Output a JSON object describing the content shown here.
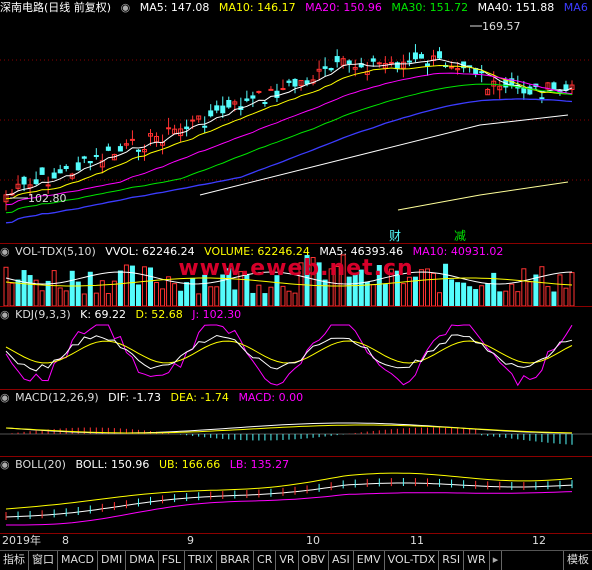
{
  "main": {
    "stock_title": "深南电路(日线 前复权)",
    "ma5": "MA5: 147.08",
    "ma10": "MA10: 146.17",
    "ma20": "MA20: 150.96",
    "ma30": "MA30: 151.72",
    "ma40": "MA40: 151.88",
    "ma6": "MA6",
    "peak_label": "169.57",
    "low_label": "102.80",
    "event1": "财",
    "event2": "减"
  },
  "vol": {
    "name": "VOL-TDX(5,10)",
    "vvol": "VVOL: 62246.24",
    "volume": "VOLUME: 62246.24",
    "ma5": "MA5: 46393.46",
    "ma10": "MA10: 40931.02"
  },
  "watermark": "www.eweb.net.cn",
  "kdj": {
    "name": "KDJ(9,3,3)",
    "k": "K: 69.22",
    "d": "D: 52.68",
    "j": "J: 102.30"
  },
  "macd": {
    "name": "MACD(12,26,9)",
    "dif": "DIF: -1.73",
    "dea": "DEA: -1.74",
    "macd": "MACD: 0.00"
  },
  "boll": {
    "name": "BOLL(20)",
    "boll": "BOLL: 150.96",
    "ub": "UB: 166.66",
    "lb": "LB: 135.27"
  },
  "axis": {
    "year": "2019年",
    "m8": "8",
    "m9": "9",
    "m10": "10",
    "m11": "11",
    "m12": "12"
  },
  "tabs": [
    "指标",
    "窗口",
    "MACD",
    "DMI",
    "DMA",
    "FSL",
    "TRIX",
    "BRAR",
    "CR",
    "VR",
    "OBV",
    "ASI",
    "EMV",
    "VOL-TDX",
    "RSI",
    "WR"
  ],
  "template_tab": "模板",
  "colors": {
    "up": "#ff3232",
    "down": "#54fcfc",
    "ma5": "#ffffff",
    "ma10": "#ffff00",
    "ma20": "#ff00ff",
    "ma30": "#00e600",
    "ma40": "#3c3cff",
    "grid": "#8b0000"
  }
}
